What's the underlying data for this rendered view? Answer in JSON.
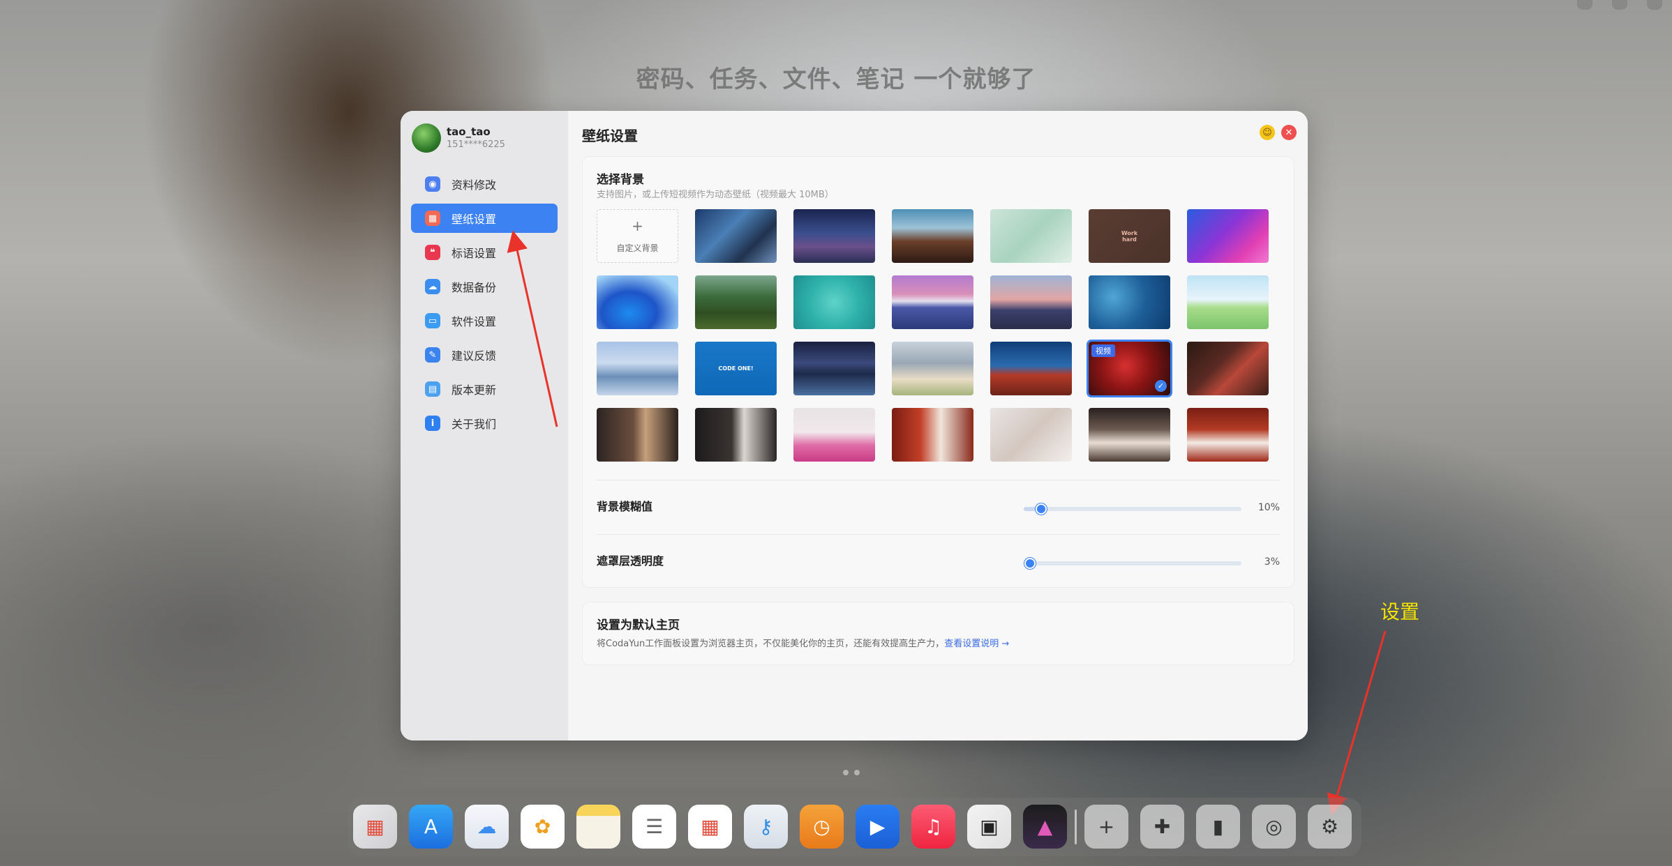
{
  "slogan": "密码、任务、文件、笔记 一个就够了",
  "profile": {
    "name": "tao_tao",
    "phone": "151****6225"
  },
  "sidebar": {
    "items": [
      {
        "label": "资料修改",
        "icon": "user-icon",
        "color": "#4d7ff0",
        "glyph": "◉"
      },
      {
        "label": "壁纸设置",
        "icon": "wallpaper-icon",
        "color": "#f06a55",
        "glyph": "▦",
        "active": true
      },
      {
        "label": "标语设置",
        "icon": "quote-icon",
        "color": "#e8374f",
        "glyph": "❝"
      },
      {
        "label": "数据备份",
        "icon": "cloud-icon",
        "color": "#3b8ef0",
        "glyph": "☁"
      },
      {
        "label": "软件设置",
        "icon": "monitor-icon",
        "color": "#3b9bf0",
        "glyph": "▭"
      },
      {
        "label": "建议反馈",
        "icon": "feedback-icon",
        "color": "#3b84f0",
        "glyph": "✎"
      },
      {
        "label": "版本更新",
        "icon": "update-icon",
        "color": "#4da2f0",
        "glyph": "▤"
      },
      {
        "label": "关于我们",
        "icon": "info-icon",
        "color": "#2e7ff0",
        "glyph": "i"
      }
    ]
  },
  "main": {
    "title": "壁纸设置",
    "minimize_icon": "minimize-icon",
    "close_icon": "close-icon",
    "background": {
      "title": "选择背景",
      "subtitle": "支持图片，或上传短视频作为动态壁纸（视频最大 10MB）",
      "add_label": "自定义背景",
      "add_glyph": "+",
      "video_badge": "视频",
      "selected_index": 18,
      "thumbs": [
        {
          "bg": "linear-gradient(135deg,#1d3a6b,#4a7fb5 40%,#20324f 70%,#6e8fb8)"
        },
        {
          "bg": "linear-gradient(180deg,#1b2450,#3b4e8d 45%,#6a4f8a 70%,#2a2f55)"
        },
        {
          "bg": "linear-gradient(180deg,#4e8fb5 0%,#9dc2d6 35%,#6b3f2a 60%,#2d1a14)"
        },
        {
          "bg": "linear-gradient(135deg,#cde4da,#a8d3bf 50%,#e0efe7)"
        },
        {
          "bg": "linear-gradient(135deg,#5a3d33,#4a322a)",
          "text": "Work\nhard",
          "tcolor": "#e8b7a3"
        },
        {
          "bg": "linear-gradient(135deg,#2a5be0,#8b35d6 45%,#e13fb3 75%,#f07ad0)"
        },
        {
          "bg": "radial-gradient(ellipse at 40% 70%,#1d8bf0,#1e55c8 40%,#a2d4f7 80%)"
        },
        {
          "bg": "linear-gradient(180deg,#7ca78c,#3b6b3c 40%,#2f4f22 70%,#4a6b2d)"
        },
        {
          "bg": "radial-gradient(circle at 50% 50%,#5fd3c8,#2fb2ab 50%,#1f8f8f)"
        },
        {
          "bg": "linear-gradient(180deg,#b37bd0 0%,#d88fb8 35%,#e4e0ef 48%,#4a58a8 60%,#2b3a7a)"
        },
        {
          "bg": "linear-gradient(180deg,#9fb3d6,#e2a6a3 45%,#3b3f6b 65%,#2a2e4a)"
        },
        {
          "bg": "radial-gradient(circle at 30% 40%,#4fa6d6,#1d5e98 50%,#0e3b6d)"
        },
        {
          "bg": "linear-gradient(180deg,#bfe3f5 0%,#e7f4fb 45%,#a7dc8a 60%,#7cc46c)"
        },
        {
          "bg": "linear-gradient(180deg,#a9c3e6,#cbdbef 40%,#6b8fb8 65%,#c5d5ea)"
        },
        {
          "bg": "linear-gradient(180deg,#1977c7,#0f68b8)",
          "text": "CODE ONE!",
          "tcolor": "#ffffff"
        },
        {
          "bg": "linear-gradient(180deg,#1a2040,#3a4a7a 40%,#1e2a4a 60%,#4a6fa0)"
        },
        {
          "bg": "linear-gradient(180deg,#c8d2dc,#9aa7b5 40%,#e8dcc6 70%,#a6b37a)"
        },
        {
          "bg": "linear-gradient(180deg,#0f3e78,#2a6bb0 45%,#b23a2a 62%,#6e2418)"
        },
        {
          "bg": "radial-gradient(circle at 45% 45%,#d83030,#8a1414 45%,#2a0c0c)"
        },
        {
          "bg": "linear-gradient(135deg,#2a1a14,#5a2a22 40%,#b8483a 60%,#3a1f18)"
        },
        {
          "bg": "linear-gradient(90deg,#2c2421,#6b4e3e 45%,#c7a07c 60%,#2b211d)"
        },
        {
          "bg": "linear-gradient(90deg,#1d1b1c,#3a3432 45%,#dcd6d0 60%,#2a2626)"
        },
        {
          "bg": "linear-gradient(180deg,#e8e3e4,#f1e9ec 45%,#e06aa6 70%,#c83c86)"
        },
        {
          "bg": "linear-gradient(90deg,#7a1e14,#c23e26 35%,#f0e6dc 60%,#8a2a1c)"
        },
        {
          "bg": "linear-gradient(135deg,#e8e4e2,#d4c7c0 50%,#f2efed)"
        },
        {
          "bg": "linear-gradient(180deg,#2a201e,#6b5a50 40%,#e8ddd4 65%,#4a3a32)"
        },
        {
          "bg": "linear-gradient(180deg,#7a1e14,#b23a24 40%,#f2ebe4 65%,#a02818)"
        }
      ]
    },
    "blur": {
      "label": "背景模糊值",
      "value": "10%",
      "level": 0.08
    },
    "mask": {
      "label": "遮罩层透明度",
      "value": "3%",
      "level": 0.03
    },
    "homepage": {
      "title": "设置为默认主页",
      "desc": "将CodaYun工作面板设置为浏览器主页，不仅能美化你的主页，还能有效提高生产力，",
      "link": "查看设置说明 →"
    }
  },
  "annotation": {
    "label": "设置",
    "color": "#f5e400"
  },
  "dock": {
    "items": [
      {
        "icon": "launchpad-icon",
        "bg": "linear-gradient(135deg,#e8e8ea,#cfcfd3)",
        "glyph": "▦",
        "color": "#e34c3c"
      },
      {
        "icon": "app-store-icon",
        "bg": "linear-gradient(180deg,#35a7f5,#1b6fe0)",
        "glyph": "A"
      },
      {
        "icon": "icloud-icon",
        "bg": "linear-gradient(180deg,#f6f7fb,#dfe4ee)",
        "glyph": "☁",
        "color": "#3b8ef0"
      },
      {
        "icon": "photos-icon",
        "bg": "#ffffff",
        "glyph": "✿",
        "color": "#f0a020"
      },
      {
        "icon": "notes-icon",
        "bg": "linear-gradient(180deg,#f8d55a 0%,#f8d55a 25%,#f6f2e6 26%)",
        "glyph": "",
        "color": "#333"
      },
      {
        "icon": "reminders-icon",
        "bg": "#ffffff",
        "glyph": "☰",
        "color": "#666"
      },
      {
        "icon": "calendar-icon",
        "bg": "#ffffff",
        "glyph": "▦",
        "color": "#e24a3a"
      },
      {
        "icon": "passwords-icon",
        "bg": "linear-gradient(180deg,#eef2f6,#d6dde6)",
        "glyph": "⚷",
        "color": "#2f8ee8"
      },
      {
        "icon": "clock-icon",
        "bg": "linear-gradient(180deg,#f5a23a,#e87a1a)",
        "glyph": "◷"
      },
      {
        "icon": "video-player-icon",
        "bg": "linear-gradient(180deg,#2b7df2,#1a5fd6)",
        "glyph": "▶"
      },
      {
        "icon": "music-icon",
        "bg": "linear-gradient(180deg,#fb5c74,#f0243f)",
        "glyph": "♫"
      },
      {
        "icon": "qr-code-icon",
        "bg": "linear-gradient(135deg,#f3f3f3,#e0e0e0)",
        "glyph": "▣",
        "color": "#222"
      },
      {
        "icon": "gallery-icon",
        "bg": "linear-gradient(180deg,#1c1c1c,#3a2a4a)",
        "glyph": "▲",
        "color": "#e05ab8"
      },
      {
        "icon": "add-icon",
        "bg": "rgba(255,255,255,0.55)",
        "glyph": "+",
        "color": "#333"
      },
      {
        "icon": "plugins-icon",
        "bg": "rgba(255,255,255,0.55)",
        "glyph": "✚",
        "color": "#333"
      },
      {
        "icon": "theme-brush-icon",
        "bg": "rgba(255,255,255,0.55)",
        "glyph": "▮",
        "color": "#333"
      },
      {
        "icon": "lock-icon",
        "bg": "rgba(255,255,255,0.55)",
        "glyph": "◎",
        "color": "#333"
      },
      {
        "icon": "settings-icon",
        "bg": "rgba(255,255,255,0.55)",
        "glyph": "⚙",
        "color": "#333"
      }
    ]
  }
}
